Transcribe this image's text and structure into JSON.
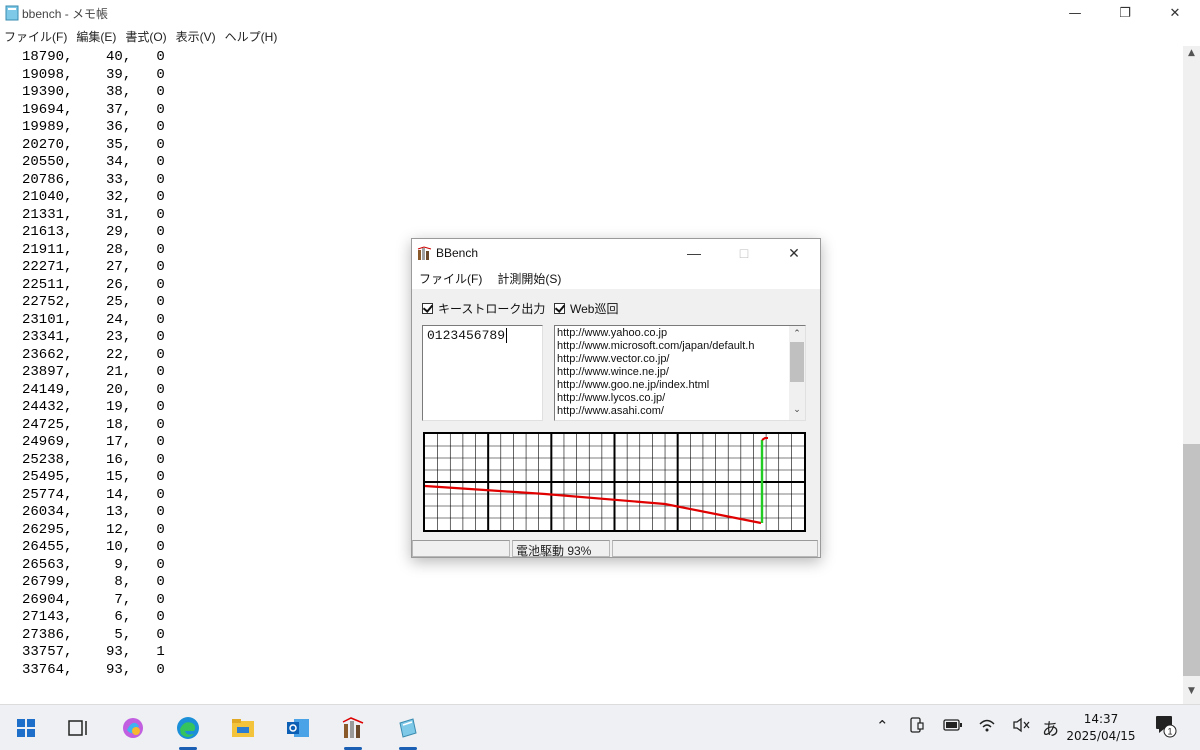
{
  "notepad": {
    "title": "bbench - メモ帳",
    "menu": [
      "ファイル(F)",
      "編集(E)",
      "書式(O)",
      "表示(V)",
      "ヘルプ(H)"
    ],
    "lines": [
      "18790,    40,   0",
      "19098,    39,   0",
      "19390,    38,   0",
      "19694,    37,   0",
      "19989,    36,   0",
      "20270,    35,   0",
      "20550,    34,   0",
      "20786,    33,   0",
      "21040,    32,   0",
      "21331,    31,   0",
      "21613,    29,   0",
      "21911,    28,   0",
      "22271,    27,   0",
      "22511,    26,   0",
      "22752,    25,   0",
      "23101,    24,   0",
      "23341,    23,   0",
      "23662,    22,   0",
      "23897,    21,   0",
      "24149,    20,   0",
      "24432,    19,   0",
      "24725,    18,   0",
      "24969,    17,   0",
      "25238,    16,   0",
      "25495,    15,   0",
      "25774,    14,   0",
      "26034,    13,   0",
      "26295,    12,   0",
      "26455,    10,   0",
      "26563,     9,   0",
      "26799,     8,   0",
      "26904,     7,   0",
      "27143,     6,   0",
      "27386,     5,   0",
      "33757,    93,   1",
      "33764,    93,   0"
    ]
  },
  "bbench": {
    "title": "BBench",
    "menu": [
      "ファイル(F)",
      "計測開始(S)"
    ],
    "keystroke_label": "キーストローク出力",
    "keystroke_checked": true,
    "web_label": "Web巡回",
    "web_checked": true,
    "keystroke_text": "0123456789",
    "urls": [
      "http://www.yahoo.co.jp",
      "http://www.microsoft.com/japan/default.h",
      "http://www.vector.co.jp/",
      "http://www.wince.ne.jp/",
      "http://www.goo.ne.jp/index.html",
      "http://www.lycos.co.jp/",
      "http://www.asahi.com/"
    ],
    "status_text": "電池駆動  93%",
    "graph_colors": {
      "battery_line": "#e00000",
      "ac_line": "#22cc22",
      "grid": "#000000"
    }
  },
  "taskbar": {
    "apps": [
      "start-icon",
      "task-view-icon",
      "copilot-icon",
      "edge-icon",
      "explorer-icon",
      "outlook-icon",
      "bbench-icon",
      "notepad-icon"
    ],
    "ime": "あ",
    "time": "14:37",
    "date": "2025/04/15",
    "notification_count": "1"
  }
}
